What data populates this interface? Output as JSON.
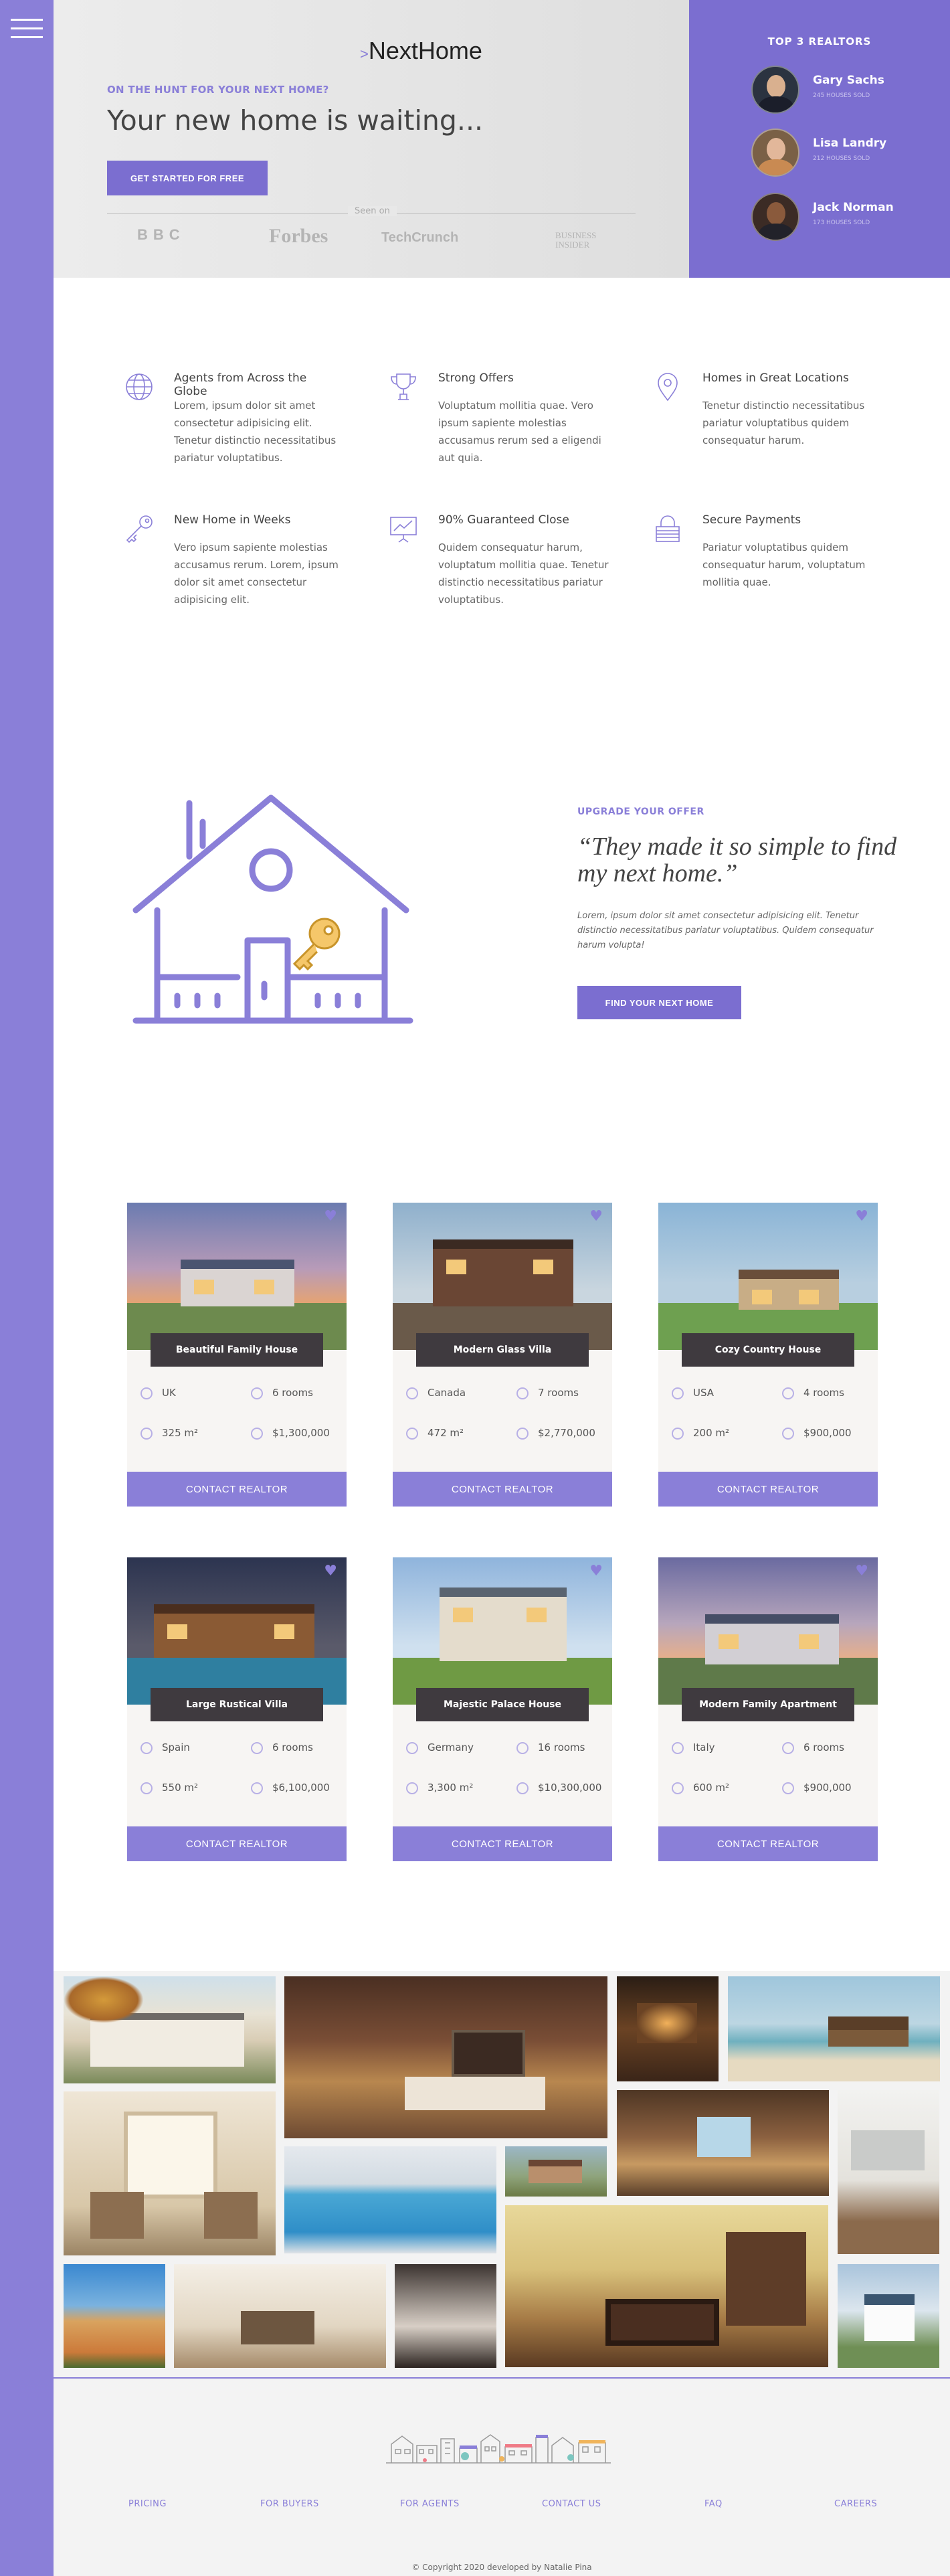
{
  "header": {
    "logo": "NextHome",
    "logo_mark": ">",
    "kicker": "ON THE HUNT FOR YOUR NEXT HOME?",
    "headline": "Your new home is waiting...",
    "cta": "GET STARTED FOR FREE",
    "seen_on": "Seen on",
    "press": [
      "BBC",
      "Forbes",
      "TechCrunch",
      "BUSINESS INSIDER"
    ]
  },
  "realtors": {
    "title": "TOP 3 REALTORS",
    "items": [
      {
        "name": "Gary Sachs",
        "sold": "245 HOUSES SOLD"
      },
      {
        "name": "Lisa Landry",
        "sold": "212 HOUSES SOLD"
      },
      {
        "name": "Jack Norman",
        "sold": "173 HOUSES SOLD"
      }
    ]
  },
  "features": [
    {
      "icon": "globe-icon",
      "title": "Agents from Across the Globe",
      "text": "Lorem, ipsum dolor sit amet consectetur adipisicing elit. Tenetur distinctio necessitatibus pariatur voluptatibus."
    },
    {
      "icon": "trophy-icon",
      "title": "Strong Offers",
      "text": "Voluptatum mollitia quae. Vero ipsum sapiente molestias accusamus rerum sed a eligendi aut quia."
    },
    {
      "icon": "map-pin-icon",
      "title": "Homes in Great Locations",
      "text": "Tenetur distinctio necessitatibus pariatur voluptatibus quidem consequatur harum."
    },
    {
      "icon": "key-icon",
      "title": "New Home in Weeks",
      "text": "Vero ipsum sapiente molestias accusamus rerum. Lorem, ipsum dolor sit amet consectetur adipisicing elit."
    },
    {
      "icon": "chart-board-icon",
      "title": "90% Guaranteed Close",
      "text": "Quidem consequatur harum, voluptatum mollitia quae. Tenetur distinctio necessitatibus pariatur voluptatibus."
    },
    {
      "icon": "lock-icon",
      "title": "Secure Payments",
      "text": "Pariatur voluptatibus quidem consequatur harum, voluptatum mollitia quae."
    }
  ],
  "story": {
    "kicker": "UPGRADE YOUR OFFER",
    "quote": "“They made it so simple to find my next home.”",
    "text": "Lorem, ipsum dolor sit amet consectetur adipisicing elit. Tenetur distinctio necessitatibus pariatur voluptatibus. Quidem consequatur harum volupta!",
    "cta": "FIND YOUR NEXT HOME"
  },
  "homes": [
    {
      "title": "Beautiful Family House",
      "country": "UK",
      "rooms": "6 rooms",
      "area": "325 m²",
      "price": "$1,300,000",
      "button": "CONTACT REALTOR"
    },
    {
      "title": "Modern Glass Villa",
      "country": "Canada",
      "rooms": "7 rooms",
      "area": "472 m²",
      "price": "$2,770,000",
      "button": "CONTACT REALTOR"
    },
    {
      "title": "Cozy Country House",
      "country": "USA",
      "rooms": "4 rooms",
      "area": "200 m²",
      "price": "$900,000",
      "button": "CONTACT REALTOR"
    },
    {
      "title": "Large Rustical Villa",
      "country": "Spain",
      "rooms": "6 rooms",
      "area": "550 m²",
      "price": "$6,100,000",
      "button": "CONTACT REALTOR"
    },
    {
      "title": "Majestic Palace House",
      "country": "Germany",
      "rooms": "16 rooms",
      "area": "3,300 m²",
      "price": "$10,300,000",
      "button": "CONTACT REALTOR"
    },
    {
      "title": "Modern Family Apartment",
      "country": "Italy",
      "rooms": "6 rooms",
      "area": "600 m²",
      "price": "$900,000",
      "button": "CONTACT REALTOR"
    }
  ],
  "footer": {
    "nav": [
      "PRICING",
      "FOR BUYERS",
      "FOR AGENTS",
      "CONTACT US",
      "FAQ",
      "CAREERS"
    ],
    "copyright": "© Copyright 2020 developed by Natalie Pina"
  },
  "colors": {
    "accent": "#8a7fd8",
    "accent_dark": "#7b6ed0",
    "card_title_bg": "#3f3a3f"
  }
}
